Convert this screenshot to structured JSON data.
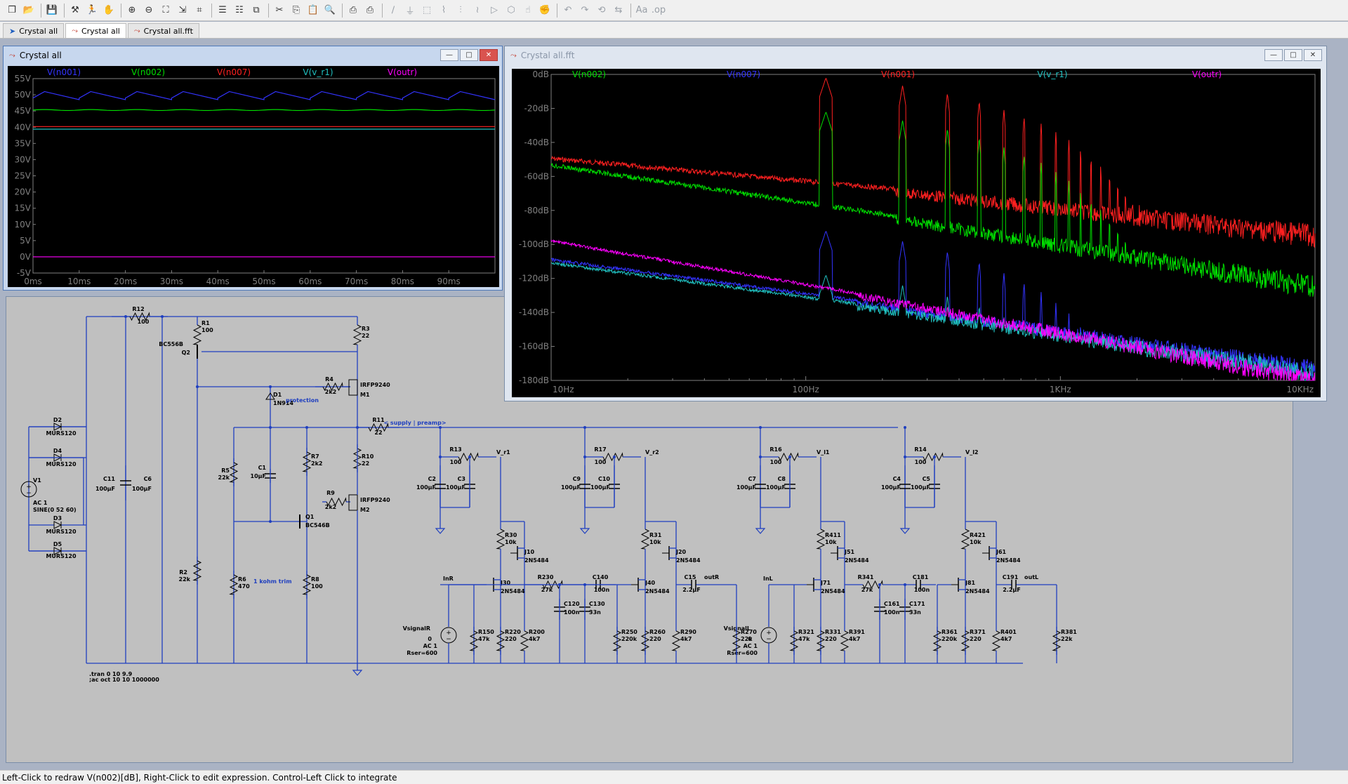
{
  "toolbar": {
    "buttons": [
      "new-schematic-icon",
      "open-icon",
      "save-icon",
      "control-panel-icon",
      "run-icon",
      "halt-icon",
      "zoom-in-icon",
      "zoom-out-icon",
      "zoom-fit-icon",
      "autorange-icon",
      "grid-icon",
      "tile-h-icon",
      "tile-v-icon",
      "cascade-icon",
      "cut-icon",
      "copy-icon",
      "paste-icon",
      "find-icon",
      "print-icon",
      "print-setup-icon",
      "wire-icon",
      "ground-icon",
      "label-icon",
      "resistor-icon",
      "capacitor-icon",
      "inductor-icon",
      "diode-icon",
      "component-icon",
      "move-icon",
      "drag-icon",
      "undo-icon",
      "redo-icon",
      "rotate-icon",
      "mirror-icon",
      "text-icon",
      "spice-directive-icon"
    ]
  },
  "tabs": [
    {
      "label": "Crystal all",
      "icon": "schematic-icon",
      "active": false
    },
    {
      "label": "Crystal all",
      "icon": "waveform-icon",
      "active": true
    },
    {
      "label": "Crystal all.fft",
      "icon": "waveform-icon",
      "active": false
    }
  ],
  "time_window": {
    "title": "Crystal all",
    "traces": [
      {
        "label": "V(n001)",
        "color": "#3333ff"
      },
      {
        "label": "V(n002)",
        "color": "#00dd00"
      },
      {
        "label": "V(n007)",
        "color": "#ff2020"
      },
      {
        "label": "V(v_r1)",
        "color": "#20c0c0"
      },
      {
        "label": "V(outr)",
        "color": "#ff00ff"
      }
    ]
  },
  "fft_window": {
    "title": "Crystal all.fft",
    "traces": [
      {
        "label": "V(n002)",
        "color": "#00dd00"
      },
      {
        "label": "V(n007)",
        "color": "#3333ff"
      },
      {
        "label": "V(n001)",
        "color": "#ff2020"
      },
      {
        "label": "V(v_r1)",
        "color": "#20c0c0"
      },
      {
        "label": "V(outr)",
        "color": "#ff00ff"
      }
    ]
  },
  "chart_data": [
    {
      "type": "line",
      "title": "",
      "xlabel": "",
      "ylabel": "",
      "x_ticks": [
        "0ms",
        "10ms",
        "20ms",
        "30ms",
        "40ms",
        "50ms",
        "60ms",
        "70ms",
        "80ms",
        "90ms"
      ],
      "y_ticks": [
        "55V",
        "50V",
        "45V",
        "40V",
        "35V",
        "30V",
        "25V",
        "20V",
        "15V",
        "10V",
        "5V",
        "0V",
        "-5V"
      ],
      "xlim": [
        0,
        100
      ],
      "ylim": [
        -5,
        55
      ],
      "x_unit": "ms",
      "y_unit": "V",
      "series": [
        {
          "name": "V(n001)",
          "approx": "sawtooth ripple 48.5 to 51 V, 100 Hz"
        },
        {
          "name": "V(n002)",
          "values_const": 45.3
        },
        {
          "name": "V(n007)",
          "values_const": 40.2
        },
        {
          "name": "V(v_r1)",
          "values_const": 39.4
        },
        {
          "name": "V(outr)",
          "values_const": 0
        }
      ]
    },
    {
      "type": "line",
      "title": "",
      "xlabel": "",
      "ylabel": "",
      "x_ticks": [
        "10Hz",
        "100Hz",
        "1KHz",
        "10KHz"
      ],
      "y_ticks": [
        "0dB",
        "-20dB",
        "-40dB",
        "-60dB",
        "-80dB",
        "-100dB",
        "-120dB",
        "-140dB",
        "-160dB",
        "-180dB"
      ],
      "x_scale": "log",
      "xlim": [
        10,
        10000
      ],
      "ylim": [
        -180,
        0
      ],
      "harmonic_peaks_hz": [
        120,
        240,
        360,
        480,
        600
      ],
      "series": [
        {
          "name": "V(n001)",
          "peak_db": -2,
          "floor_db_10hz": -48,
          "floor_db_10khz": -88
        },
        {
          "name": "V(n002)",
          "peak_db": -22,
          "floor_db_10hz": -52,
          "floor_db_10khz": -118
        },
        {
          "name": "V(n007)",
          "peak_db": -92,
          "floor_db_10hz": -108,
          "floor_db_10khz": -168
        },
        {
          "name": "V(v_r1)",
          "peak_db": -118,
          "floor_db_10hz": -110,
          "floor_db_10khz": -170
        },
        {
          "name": "V(outr)",
          "peak_db": -128,
          "floor_db_10hz": -97,
          "floor_db_10khz": -174
        }
      ]
    }
  ],
  "schematic": {
    "labels": {
      "r12": "R12",
      "r12v": "100",
      "r1": "R1",
      "r1v": "100",
      "q2": "BC556B",
      "q2n": "Q2",
      "r3": "R3",
      "r3v": "22",
      "r4": "R4",
      "r4v": "2k2",
      "m1": "IRFP9240",
      "m1n": "M1",
      "d1": "D1",
      "d1v": "1N914",
      "prot": "protection",
      "r11": "R11",
      "r11v": "22",
      "supply": "< supply | preamp>",
      "r5": "R5",
      "r5v": "22k",
      "c1": "C1",
      "c1v": "10µF",
      "r7": "R7",
      "r7v": "2k2",
      "r10": "R10",
      "r10v": "22",
      "r9": "R9",
      "r9v": "2k2",
      "m2": "IRFP9240",
      "m2n": "M2",
      "q1": "Q1",
      "q1v": "BC546B",
      "r2": "R2",
      "r2v": "22k",
      "r6": "R6",
      "r6v": "470",
      "trim": "1 kohm trim",
      "r8": "R8",
      "r8v": "100",
      "d2": "D2",
      "d2v": "MURS120",
      "d4": "D4",
      "d4v": "MURS120",
      "d3": "D3",
      "d3v": "MURS120",
      "d5": "D5",
      "d5v": "MURS120",
      "v1": "V1",
      "v1a": "AC 1",
      "v1b": "SINE(0 52 60)",
      "c11": "C11",
      "c11v": "100µF",
      "c6": "C6",
      "c6v": "100µF",
      "tran": ".tran 0 10 9.9",
      ";ac": ";ac oct 10 10 1000000",
      "r13": "R13",
      "r13v": "100",
      "vr1": "V_r1",
      "c2": "C2",
      "c2v": "100µF",
      "c3": "C3",
      "c3v": "100µF",
      "r30": "R30",
      "r30v": "10k",
      "j10": "J10",
      "j10v": "2N5484",
      "j30": "J30",
      "j30v": "2N5484",
      "inr": "InR",
      "r230": "R230",
      "r230v": "27k",
      "c140": "C140",
      "c140v": "100n",
      "c120": "C120",
      "c120v": "100n",
      "c130": "C130",
      "c130v": "33n",
      "r150": "R150",
      "r150v": "47k",
      "r220": "R220",
      "r220v": "220",
      "r200": "R200",
      "r200v": "4k7",
      "r240": "R240",
      "r240v": "3k3",
      "vsr": "VsignalR",
      "vsr0": "0",
      "vsra": "AC 1",
      "vsrs": "Rser=600",
      "r17": "R17",
      "r17v": "100",
      "vr2": "V_r2",
      "c9": "C9",
      "c9v": "100µF",
      "c10": "C10",
      "c10v": "100µF",
      "r31": "R31",
      "r31v": "10k",
      "j20": "J20",
      "j20v": "2N5484",
      "j40": "J40",
      "j40v": "2N5484",
      "c15": "C15",
      "c15v": "2.2µF",
      "outr": "outR",
      "r250": "R250",
      "r250v": "220k",
      "r260": "R260",
      "r260v": "220",
      "r290": "R290",
      "r290v": "4k7",
      "r270": "R270",
      "r270v": "22k",
      "r16": "R16",
      "r16v": "100",
      "vl1": "V_l1",
      "c7": "C7",
      "c7v": "100µF",
      "c8": "C8",
      "c8v": "100µF",
      "r411": "R411",
      "r411v": "10k",
      "j51": "J51",
      "j51v": "2N5484",
      "j71": "J71",
      "j71v": "2N5484",
      "inl": "InL",
      "r341": "R341",
      "r341v": "27k",
      "c181": "C181",
      "c181v": "100n",
      "c161": "C161",
      "c161v": "100n",
      "c171": "C171",
      "c171v": "33n",
      "r321": "R321",
      "r321v": "47k",
      "r331": "R331",
      "r331v": "220",
      "r391": "R391",
      "r391v": "4k7",
      "r351": "R351",
      "r351v": "3k3",
      "vsl": "VsignalL",
      "vsl0": "0",
      "vsla": "AC 1",
      "vsls": "Rser=600",
      "r14": "R14",
      "r14v": "100",
      "vl2": "V_l2",
      "c4": "C4",
      "c4v": "100µF",
      "c5": "C5",
      "c5v": "100µF",
      "r421": "R421",
      "r421v": "10k",
      "j61": "J61",
      "j61v": "2N5484",
      "j81": "J81",
      "j81v": "2N5484",
      "c191": "C191",
      "c191v": "2.2µF",
      "outl": "outL",
      "r361": "R361",
      "r361v": "220k",
      "r371": "R371",
      "r371v": "220",
      "r401": "R401",
      "r401v": "4k7",
      "r381": "R381",
      "r381v": "22k"
    }
  },
  "status": "Left-Click to redraw V(n002)[dB],  Right-Click to edit expression. Control-Left Click to integrate"
}
